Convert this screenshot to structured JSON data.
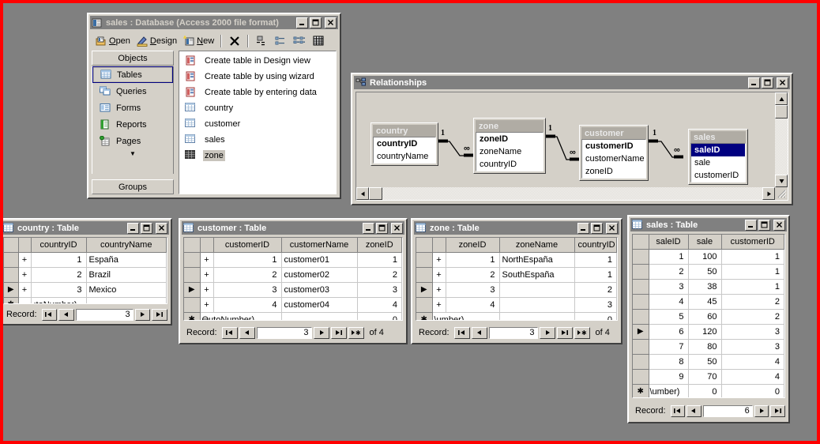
{
  "desktop": {
    "background": "#808080",
    "border_color": "#ff0000"
  },
  "database_window": {
    "title": "sales : Database (Access 2000 file format)",
    "icon": "database-icon",
    "titlebar_buttons": [
      {
        "name": "minimize-button",
        "glyph": "_"
      },
      {
        "name": "maximize-button",
        "glyph": "□"
      },
      {
        "name": "close-button",
        "glyph": "✕"
      }
    ],
    "toolbar": {
      "open_label": "Open",
      "design_label": "Design",
      "new_label": "New",
      "delete_label": "✕",
      "icons": [
        "open-icon",
        "design-icon",
        "new-icon",
        "delete-icon",
        "large-icons-icon",
        "small-icons-icon",
        "list-icon",
        "details-icon"
      ]
    },
    "objects_panel": {
      "header": "Objects",
      "footer": "Groups",
      "items": [
        {
          "label": "Tables",
          "icon": "table-icon",
          "selected": true
        },
        {
          "label": "Queries",
          "icon": "query-icon",
          "selected": false
        },
        {
          "label": "Forms",
          "icon": "form-icon",
          "selected": false
        },
        {
          "label": "Reports",
          "icon": "report-icon",
          "selected": false
        },
        {
          "label": "Pages",
          "icon": "page-icon",
          "selected": false
        }
      ],
      "more_glyph": "▼"
    },
    "tables_list": [
      {
        "label": "Create table in Design view",
        "icon": "new-object-icon",
        "selected": false
      },
      {
        "label": "Create table by using wizard",
        "icon": "new-object-icon",
        "selected": false
      },
      {
        "label": "Create table by entering data",
        "icon": "new-object-icon",
        "selected": false
      },
      {
        "label": "country",
        "icon": "table-icon",
        "selected": false
      },
      {
        "label": "customer",
        "icon": "table-icon",
        "selected": false
      },
      {
        "label": "sales",
        "icon": "table-icon",
        "selected": false
      },
      {
        "label": "zone",
        "icon": "table-icon",
        "selected": true
      }
    ]
  },
  "relationships_window": {
    "title": "Relationships",
    "icon": "relationships-icon",
    "titlebar_buttons": [
      {
        "name": "minimize-button",
        "glyph": "_"
      },
      {
        "name": "maximize-button",
        "glyph": "□"
      },
      {
        "name": "close-button",
        "glyph": "✕"
      }
    ],
    "tables": [
      {
        "name": "country",
        "fields": [
          {
            "label": "countryID",
            "pk": true,
            "selected": false
          },
          {
            "label": "countryName",
            "pk": false,
            "selected": false
          }
        ]
      },
      {
        "name": "zone",
        "fields": [
          {
            "label": "zoneID",
            "pk": true,
            "selected": false
          },
          {
            "label": "zoneName",
            "pk": false,
            "selected": false
          },
          {
            "label": "countryID",
            "pk": false,
            "selected": false
          }
        ]
      },
      {
        "name": "customer",
        "fields": [
          {
            "label": "customerID",
            "pk": true,
            "selected": false
          },
          {
            "label": "customerName",
            "pk": false,
            "selected": false
          },
          {
            "label": "zoneID",
            "pk": false,
            "selected": false
          }
        ]
      },
      {
        "name": "sales",
        "fields": [
          {
            "label": "saleID",
            "pk": true,
            "selected": true
          },
          {
            "label": "sale",
            "pk": false,
            "selected": false
          },
          {
            "label": "customerID",
            "pk": false,
            "selected": false
          }
        ]
      }
    ],
    "joins": [
      {
        "one": "1",
        "many": "∞",
        "from": "country.countryID",
        "to": "zone.countryID"
      },
      {
        "one": "1",
        "many": "∞",
        "from": "zone.zoneID",
        "to": "customer.zoneID"
      },
      {
        "one": "1",
        "many": "∞",
        "from": "customer.customerID",
        "to": "sales.customerID"
      }
    ],
    "selected_field_highlight": "#000080"
  },
  "country_table": {
    "title": "country : Table",
    "icon": "datasheet-icon",
    "titlebar_buttons": [
      {
        "name": "minimize-button",
        "glyph": "_"
      },
      {
        "name": "maximize-button",
        "glyph": "□"
      },
      {
        "name": "close-button",
        "glyph": "✕"
      }
    ],
    "columns": [
      "countryID",
      "countryName"
    ],
    "rows": [
      {
        "marker": "",
        "expand": "+",
        "countryID": "1",
        "countryName": "España"
      },
      {
        "marker": "",
        "expand": "+",
        "countryID": "2",
        "countryName": "Brazil"
      },
      {
        "marker": "▶",
        "expand": "+",
        "countryID": "3",
        "countryName": "Mexico"
      }
    ],
    "new_row": {
      "marker": "✱",
      "countryID": "ıtoNumber)",
      "countryName": ""
    },
    "nav": {
      "label": "Record:",
      "value": "3",
      "of_text": "",
      "buttons": [
        "first",
        "prev",
        "next",
        "last"
      ]
    }
  },
  "customer_table": {
    "title": "customer : Table",
    "icon": "datasheet-icon",
    "titlebar_buttons": [
      {
        "name": "minimize-button",
        "glyph": "_"
      },
      {
        "name": "maximize-button",
        "glyph": "□"
      },
      {
        "name": "close-button",
        "glyph": "✕"
      }
    ],
    "columns": [
      "customerID",
      "customerName",
      "zoneID"
    ],
    "rows": [
      {
        "marker": "",
        "expand": "+",
        "customerID": "1",
        "customerName": "customer01",
        "zoneID": "1"
      },
      {
        "marker": "",
        "expand": "+",
        "customerID": "2",
        "customerName": "customer02",
        "zoneID": "2"
      },
      {
        "marker": "▶",
        "expand": "+",
        "customerID": "3",
        "customerName": "customer03",
        "zoneID": "3"
      },
      {
        "marker": "",
        "expand": "+",
        "customerID": "4",
        "customerName": "customer04",
        "zoneID": "4"
      }
    ],
    "new_row": {
      "marker": "✱",
      "customerID": "ƟutoNumber)",
      "customerName": "",
      "zoneID": "0"
    },
    "nav": {
      "label": "Record:",
      "value": "3",
      "of_text": "of  4",
      "buttons": [
        "first",
        "prev",
        "next",
        "last",
        "new"
      ]
    }
  },
  "zone_table": {
    "title": "zone : Table",
    "icon": "datasheet-icon",
    "titlebar_buttons": [
      {
        "name": "minimize-button",
        "glyph": "_"
      },
      {
        "name": "maximize-button",
        "glyph": "□"
      },
      {
        "name": "close-button",
        "glyph": "✕"
      }
    ],
    "columns": [
      "zoneID",
      "zoneName",
      "countryID"
    ],
    "rows": [
      {
        "marker": "",
        "expand": "+",
        "zoneID": "1",
        "zoneName": "NorthEspaña",
        "countryID": "1"
      },
      {
        "marker": "",
        "expand": "+",
        "zoneID": "2",
        "zoneName": "SouthEspaña",
        "countryID": "1"
      },
      {
        "marker": "▶",
        "expand": "+",
        "zoneID": "3",
        "zoneName": "",
        "countryID": "2"
      },
      {
        "marker": "",
        "expand": "+",
        "zoneID": "4",
        "zoneName": "",
        "countryID": "3"
      }
    ],
    "new_row": {
      "marker": "✱",
      "zoneID": "\\umber)",
      "zoneName": "",
      "countryID": "0"
    },
    "nav": {
      "label": "Record:",
      "value": "3",
      "of_text": "of  4",
      "buttons": [
        "first",
        "prev",
        "next",
        "last",
        "new"
      ]
    }
  },
  "sales_table": {
    "title": "sales : Table",
    "icon": "datasheet-icon",
    "titlebar_buttons": [
      {
        "name": "minimize-button",
        "glyph": "_"
      },
      {
        "name": "maximize-button",
        "glyph": "□"
      },
      {
        "name": "close-button",
        "glyph": "✕"
      }
    ],
    "columns": [
      "saleID",
      "sale",
      "customerID"
    ],
    "rows": [
      {
        "marker": "",
        "saleID": "1",
        "sale": "100",
        "customerID": "1"
      },
      {
        "marker": "",
        "saleID": "2",
        "sale": "50",
        "customerID": "1"
      },
      {
        "marker": "",
        "saleID": "3",
        "sale": "38",
        "customerID": "1"
      },
      {
        "marker": "",
        "saleID": "4",
        "sale": "45",
        "customerID": "2"
      },
      {
        "marker": "",
        "saleID": "5",
        "sale": "60",
        "customerID": "2"
      },
      {
        "marker": "▶",
        "saleID": "6",
        "sale": "120",
        "customerID": "3"
      },
      {
        "marker": "",
        "saleID": "7",
        "sale": "80",
        "customerID": "3"
      },
      {
        "marker": "",
        "saleID": "8",
        "sale": "50",
        "customerID": "4"
      },
      {
        "marker": "",
        "saleID": "9",
        "sale": "70",
        "customerID": "4"
      }
    ],
    "new_row": {
      "marker": "✱",
      "saleID": "\\umber)",
      "sale": "0",
      "customerID": "0"
    },
    "nav": {
      "label": "Record:",
      "value": "6",
      "of_text": "",
      "buttons": [
        "first",
        "prev",
        "next",
        "last"
      ]
    }
  }
}
